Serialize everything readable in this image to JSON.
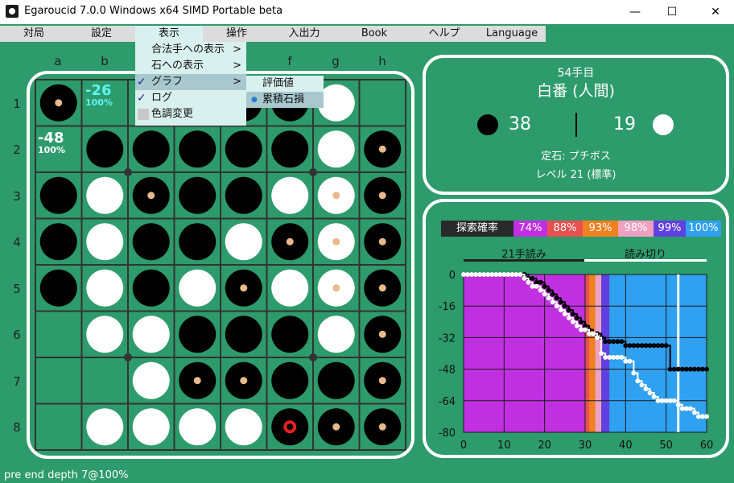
{
  "window": {
    "title": "Egaroucid 7.0.0 Windows x64 SIMD Portable beta",
    "minimize_glyph": "—",
    "maximize_glyph": "☐",
    "close_glyph": "✕"
  },
  "menubar": {
    "items": [
      "対局",
      "設定",
      "表示",
      "操作",
      "入出力",
      "Book",
      "ヘルプ",
      "Language"
    ]
  },
  "view_menu": {
    "items": [
      {
        "label": "合法手への表示",
        "arrow": ">",
        "checked": false
      },
      {
        "label": "石への表示",
        "arrow": ">",
        "checked": false
      },
      {
        "label": "グラフ",
        "arrow": ">",
        "checked": true
      },
      {
        "label": "ログ",
        "arrow": "",
        "checked": true
      },
      {
        "label": "色調変更",
        "arrow": "",
        "checked": false
      }
    ],
    "check_glyph": "✓"
  },
  "graph_submenu": {
    "items": [
      {
        "label": "評価値",
        "selected": false
      },
      {
        "label": "累積石損",
        "selected": true
      }
    ],
    "selected_glyph": "●"
  },
  "board": {
    "columns": [
      "a",
      "b",
      "c",
      "d",
      "e",
      "f",
      "g",
      "h"
    ],
    "rows": [
      "1",
      "2",
      "3",
      "4",
      "5",
      "6",
      "7",
      "8"
    ],
    "cells": [
      "B...BBW.",
      ".BBBBBWB",
      "BWBBBWWB",
      "BWBBWBWB",
      "BWBWBWWB",
      ".WWBBBWB",
      "..WBBBBB",
      ".WWWWBBB"
    ],
    "markers": [
      "a1",
      "h2",
      "c3",
      "g3",
      "h3",
      "f4",
      "g4",
      "h4",
      "e5",
      "g5",
      "h5",
      "h6",
      "d7",
      "e7",
      "h7",
      "g8",
      "h8"
    ],
    "last_move": "f8",
    "evals": {
      "a2": {
        "score": "-48",
        "percent": "100%"
      },
      "b1": {
        "score": "-26",
        "percent": "100%"
      }
    },
    "colors": {
      "board": "#2d9b6b",
      "grid": "#333333",
      "last_move": "#e82020",
      "marker": "#e8b98a",
      "eval_best": "#5ff4f4"
    }
  },
  "info": {
    "move_number": "54手目",
    "turn": "白番 (人間)",
    "black_count": "38",
    "white_count": "19",
    "opening": "定石: プチボス",
    "level": "レベル 21 (標準)"
  },
  "graph": {
    "legend_title": "探索確率",
    "legend": [
      {
        "label": "74%",
        "color": "#c030e0"
      },
      {
        "label": "88%",
        "color": "#e85050"
      },
      {
        "label": "93%",
        "color": "#f08020"
      },
      {
        "label": "98%",
        "color": "#f0a0c0"
      },
      {
        "label": "99%",
        "color": "#6040e0"
      },
      {
        "label": "100%",
        "color": "#30a0f0"
      }
    ],
    "phase_labels": [
      "21手読み",
      "読み切り"
    ]
  },
  "chart_data": {
    "type": "line",
    "title": "",
    "xlabel": "",
    "ylabel": "",
    "xlim": [
      0,
      60
    ],
    "ylim": [
      -80,
      0
    ],
    "xticks": [
      0,
      10,
      20,
      30,
      40,
      50,
      60
    ],
    "yticks": [
      0,
      -16,
      -32,
      -48,
      -64,
      -80
    ],
    "current_move": 53,
    "bands": [
      {
        "from": 0,
        "to": 30,
        "label": "74%"
      },
      {
        "from": 30,
        "to": 31,
        "label": "88%"
      },
      {
        "from": 31,
        "to": 32.5,
        "label": "93%"
      },
      {
        "from": 32.5,
        "to": 34,
        "label": "98%"
      },
      {
        "from": 34,
        "to": 36,
        "label": "99%"
      },
      {
        "from": 36,
        "to": 60,
        "label": "100%"
      }
    ],
    "series": [
      {
        "color": "#000000",
        "x": [
          0,
          1,
          2,
          3,
          4,
          5,
          6,
          7,
          8,
          9,
          10,
          11,
          12,
          13,
          14,
          15,
          16,
          17,
          18,
          19,
          20,
          21,
          22,
          23,
          24,
          25,
          26,
          27,
          28,
          29,
          30,
          31,
          32,
          33,
          34,
          35,
          36,
          37,
          38,
          39,
          40,
          41,
          42,
          43,
          44,
          45,
          46,
          47,
          48,
          49,
          50,
          51,
          52,
          53,
          54,
          55,
          56,
          57,
          58,
          59,
          60
        ],
        "y": [
          0,
          0,
          0,
          0,
          0,
          0,
          0,
          0,
          0,
          0,
          0,
          0,
          0,
          0,
          0,
          0,
          -2,
          -2,
          -4,
          -4,
          -6,
          -8,
          -10,
          -12,
          -14,
          -16,
          -18,
          -20,
          -22,
          -24,
          -26,
          -28,
          -30,
          -30,
          -32,
          -34,
          -34,
          -34,
          -34,
          -34,
          -36,
          -36,
          -36,
          -36,
          -36,
          -36,
          -36,
          -36,
          -36,
          -36,
          -36,
          -48,
          -48,
          -48,
          -48,
          -48,
          -48,
          -48,
          -48,
          -48,
          -48
        ]
      },
      {
        "color": "#ffffff",
        "x": [
          0,
          1,
          2,
          3,
          4,
          5,
          6,
          7,
          8,
          9,
          10,
          11,
          12,
          13,
          14,
          15,
          16,
          17,
          18,
          19,
          20,
          21,
          22,
          23,
          24,
          25,
          26,
          27,
          28,
          29,
          30,
          31,
          32,
          33,
          34,
          35,
          36,
          37,
          38,
          39,
          40,
          41,
          42,
          43,
          44,
          45,
          46,
          47,
          48,
          49,
          50,
          51,
          52,
          53,
          54,
          55,
          56,
          57,
          58,
          59,
          60
        ],
        "y": [
          0,
          0,
          0,
          0,
          0,
          0,
          0,
          0,
          0,
          0,
          0,
          0,
          0,
          0,
          0,
          -2,
          -4,
          -6,
          -6,
          -8,
          -10,
          -12,
          -14,
          -16,
          -18,
          -20,
          -22,
          -24,
          -26,
          -28,
          -28,
          -30,
          -30,
          -32,
          -40,
          -42,
          -42,
          -42,
          -42,
          -42,
          -44,
          -44,
          -50,
          -54,
          -56,
          -58,
          -60,
          -62,
          -64,
          -64,
          -64,
          -64,
          -64,
          -66,
          -68,
          -68,
          -68,
          -70,
          -72,
          -72,
          -72
        ]
      }
    ]
  },
  "status": "pre end depth 7@100%"
}
